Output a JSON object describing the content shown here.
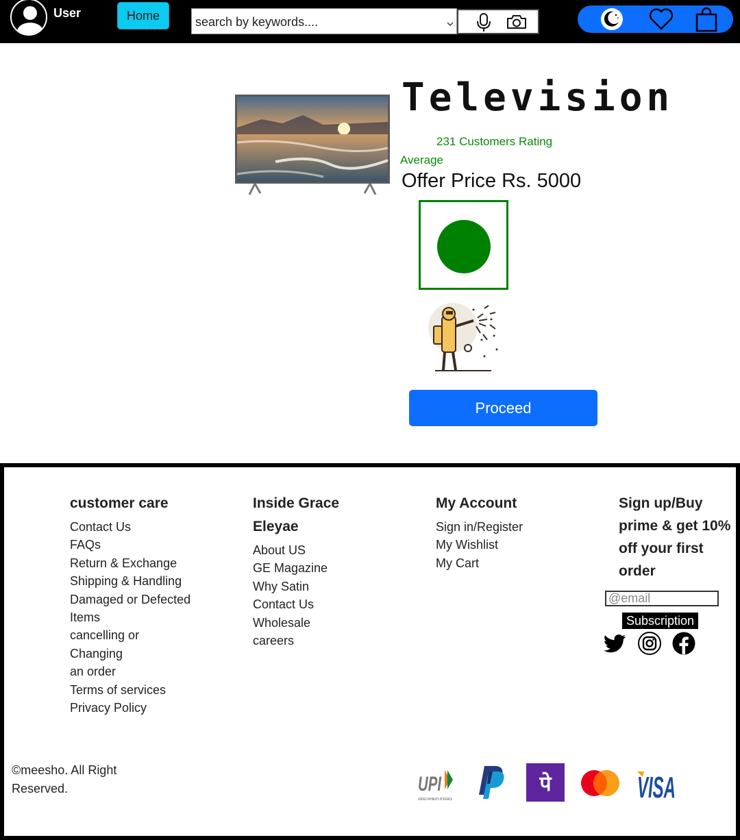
{
  "header": {
    "user_label": "User",
    "home_label": "Home",
    "search_placeholder": "search by keywords....",
    "icons": [
      "user-avatar-icon",
      "microphone-icon",
      "camera-icon",
      "moon-icon",
      "heart-icon",
      "shopping-bag-icon"
    ],
    "colors": {
      "bar": "#000000",
      "home_button": "#0dcaf0",
      "icon_pill": "#0d6efd"
    }
  },
  "product": {
    "title": "Television",
    "rating_text": "231 Customers Rating",
    "rating_level": "Average",
    "price_text": "Offer Price Rs. 5000",
    "proceed_label": "Proceed",
    "colors": {
      "rating": "#098b09",
      "veg_mark": "#008000",
      "proceed": "#0d6efd"
    }
  },
  "footer": {
    "customer_care": {
      "heading": "customer care",
      "links": [
        "Contact Us",
        "FAQs",
        "Return & Exchange",
        "Shipping & Handling",
        "Damaged or Defected",
        "Items",
        "cancelling or",
        "Changing",
        "an order",
        "Terms of services",
        "Privacy Policy"
      ]
    },
    "inside": {
      "heading_line1": "Inside Grace",
      "heading_line2": "Eleyae",
      "links": [
        "About US",
        "GE Magazine",
        "Why Satin",
        "Contact Us",
        "Wholesale",
        "careers"
      ]
    },
    "account": {
      "heading": "My Account",
      "links": [
        "Sign in/Register",
        "My Wishlist",
        "My Cart"
      ]
    },
    "signup": {
      "heading_lines": [
        "Sign up/Buy",
        "prime & get 10%",
        "off your first",
        "order"
      ],
      "email_placeholder": "@email",
      "subscribe_label": "Subscription",
      "social_icons": [
        "twitter-icon",
        "instagram-icon",
        "facebook-icon"
      ]
    },
    "copyright_line1": "©meesho. All Right",
    "copyright_line2": "Reserved.",
    "payments": {
      "upi": {
        "logo_text": "UPI",
        "tagline": "UNIFIED PAYMENTS INTERFACE"
      },
      "paypal": "paypal-logo",
      "phonepe": {
        "glyph": "पे"
      },
      "mastercard": "mastercard-logo",
      "visa": {
        "logo_text": "VISA"
      }
    }
  }
}
